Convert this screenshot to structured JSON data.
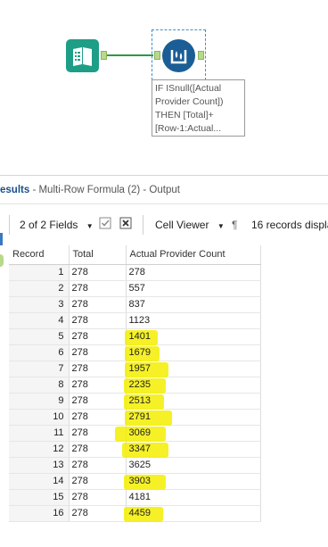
{
  "workflow": {
    "input_tool_icon": "book-icon",
    "formula_tool_icon": "multi-row-formula-icon",
    "annotation_lines": [
      "IF ISnull([Actual",
      "Provider Count])",
      "THEN [Total]+",
      "[Row-1:Actual..."
    ]
  },
  "results": {
    "title": "esults",
    "subtitle": " - Multi-Row Formula (2) - Output",
    "fields_label": "2 of 2 Fields",
    "cell_viewer_label": "Cell Viewer",
    "records_label": "16 records displa",
    "columns": [
      "Record",
      "Total",
      "Actual Provider Count"
    ],
    "rows": [
      {
        "record": "1",
        "total": "278",
        "actual": "278",
        "hl": false
      },
      {
        "record": "2",
        "total": "278",
        "actual": "557",
        "hl": false
      },
      {
        "record": "3",
        "total": "278",
        "actual": "837",
        "hl": false
      },
      {
        "record": "4",
        "total": "278",
        "actual": "1123",
        "hl": false
      },
      {
        "record": "5",
        "total": "278",
        "actual": "1401",
        "hl": true
      },
      {
        "record": "6",
        "total": "278",
        "actual": "1679",
        "hl": true
      },
      {
        "record": "7",
        "total": "278",
        "actual": "1957",
        "hl": true
      },
      {
        "record": "8",
        "total": "278",
        "actual": "2235",
        "hl": true
      },
      {
        "record": "9",
        "total": "278",
        "actual": "2513",
        "hl": true
      },
      {
        "record": "10",
        "total": "278",
        "actual": "2791",
        "hl": true
      },
      {
        "record": "11",
        "total": "278",
        "actual": "3069",
        "hl": true
      },
      {
        "record": "12",
        "total": "278",
        "actual": "3347",
        "hl": true
      },
      {
        "record": "13",
        "total": "278",
        "actual": "3625",
        "hl": false
      },
      {
        "record": "14",
        "total": "278",
        "actual": "3903",
        "hl": true
      },
      {
        "record": "15",
        "total": "278",
        "actual": "4181",
        "hl": false
      },
      {
        "record": "16",
        "total": "278",
        "actual": "4459",
        "hl": true
      }
    ]
  },
  "colors": {
    "input_tool": "#1e9e86",
    "formula_tool": "#1a5e95",
    "connector": "#2b9a48",
    "highlight": "#f3ee00"
  }
}
